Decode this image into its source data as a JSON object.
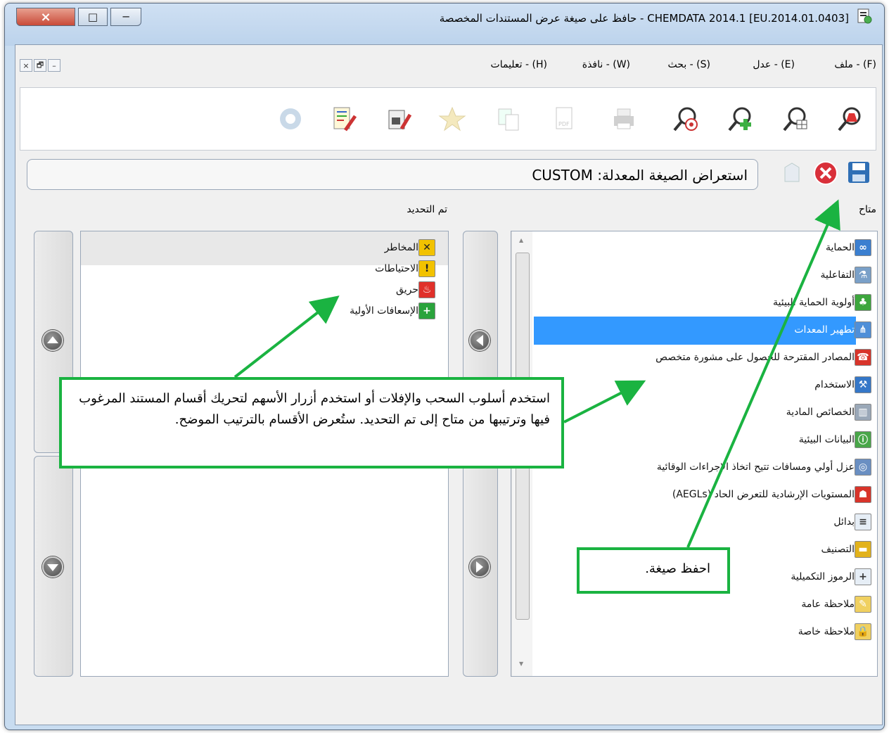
{
  "window": {
    "title": "CHEMDATA 2014.1  [EU.2014.01.0403] - حافظ على صيغة عرض المستندات المخصصة",
    "controls": {
      "close": "×",
      "maximize": "□",
      "minimize": "─"
    }
  },
  "menubar": {
    "items": [
      "(F) - ملف",
      "(E) - عدل",
      "(S) - بحث",
      "(W) - نافذة",
      "(H) - تعليمات"
    ],
    "mdi": [
      "×",
      "🗗",
      "–"
    ]
  },
  "toolbar": {
    "icons": [
      "search-chemical-icon",
      "search-table-icon",
      "search-add-icon",
      "search-target-icon",
      "print-icon",
      "pdf-icon",
      "copy-icon",
      "favorite-star-icon",
      "edit-security-icon",
      "edit-document-icon",
      "help-icon"
    ]
  },
  "format": {
    "label": "استعراض الصيغة المعدلة: CUSTOM",
    "save_icon": "save-icon",
    "cancel_icon": "cancel-icon",
    "clear_icon": "eraser-icon"
  },
  "available": {
    "label": "متاح",
    "items": [
      "الحماية",
      "التفاعلية",
      "أولوية الحماية البيئية",
      "تطهير المعدات",
      "المصادر المقترحة للحصول على مشورة متخصص",
      "الاستخدام",
      "الخصائص المادية",
      "البيانات البيئية",
      "عزل أولي ومسافات تتيح اتخاذ الإجراءات الوقائية",
      "المستويات الإرشادية للتعرض الحاد (AEGLs)",
      "بدائل",
      "التصنيف",
      "الرموز التكميلية",
      "ملاحظة عامة",
      "ملاحظة خاصة"
    ],
    "selected_index": 3
  },
  "selected": {
    "label": "تم التحديد",
    "items": [
      "المخاطر",
      "الاحتياطات",
      "حريق",
      "الإسعافات الأولية"
    ]
  },
  "callouts": {
    "instructions": "استخدم أسلوب السحب والإفلات أو استخدم أزرار الأسهم لتحريك أقسام المستند المرغوب فيها وترتيبها من متاح إلى تم التحديد. ستُعرض الأقسام بالترتيب الموضح.",
    "save": "احفظ صيغة."
  },
  "colors": {
    "accent": "#1ab341",
    "selection": "#3399ff"
  }
}
